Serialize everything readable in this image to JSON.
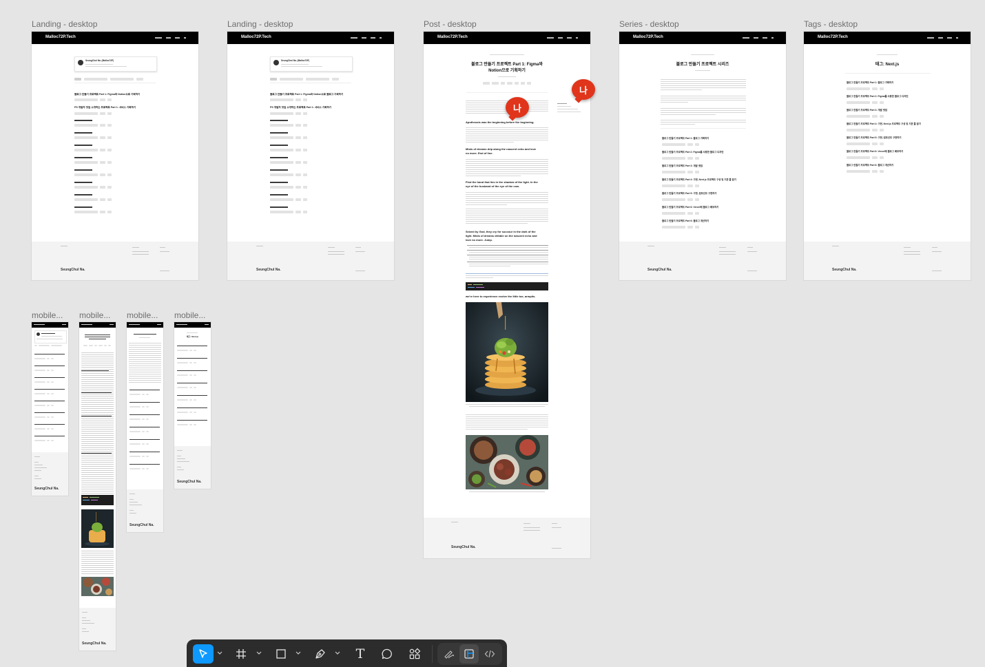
{
  "frames": {
    "landing_1": {
      "label": "Landing - desktop",
      "brand": "Malloc72P.Tech",
      "footer_name": "SeungChul Na.",
      "profile_name": "SeungChul Na. (Malloc72P)",
      "posts": [
        "블로그 만들기 프로젝트 Part 1: Figma와 Notion으로 기획하기",
        "PS 개발자 맛집 소개하는 프로젝트 Part 1: 서비스 기획하기"
      ]
    },
    "landing_2": {
      "label": "Landing - desktop",
      "brand": "Malloc72P.Tech",
      "footer_name": "SeungChul Na.",
      "profile_name": "SeungChul Na. (Malloc72P)",
      "posts": [
        "블로그 만들기 프로젝트 Part 1: Figma와 Notion으로 블로그 기획하기",
        "PS 개발자 맛집 소개하는 프로젝트 Part 1: 서비스 기획하기"
      ]
    },
    "post": {
      "label": "Post - desktop",
      "brand": "Malloc72P.Tech",
      "footer_name": "SeungChul Na.",
      "title_line1": "블로그 만들기 프로젝트 Part 1: Figma와",
      "title_line2": "Notion으로 기획하기",
      "h1": "Apotheosis was the beginning before the beginning.",
      "h2_line1": "Mists of dreams drip along the nascent echo and love",
      "h2_line2": "no more. End of line.",
      "h3_line1": "Find the hand that lies in the shadow of the light. In the",
      "h3_line2": "eye of the husband of the eye of the cow.",
      "h4_line1": "Seized by God, they cry for succour in the dark of the",
      "h4_line2": "light. Mists of dreams dribble on the nascent echo and",
      "h4_line3": "love no more. Jump.",
      "h5": "we're here to experience evolve the little toe, armpits."
    },
    "series": {
      "label": "Series - desktop",
      "brand": "Malloc72P.Tech",
      "footer_name": "SeungChul Na.",
      "title": "블로그 만들기 프로젝트 시리즈",
      "posts": [
        "블로그 만들기 프로젝트 Part 1: 블로그 기획하기",
        "블로그 만들기 프로젝트 Part 2: Figma를 사용한 블로그 디자인",
        "블로그 만들기 프로젝트 Part 3: 개발 셋업",
        "블로그 만들기 프로젝트 Part 4: 구현, Next.js 프로젝트 구성 및 기본 틀 잡기",
        "블로그 만들기 프로젝트 Part 5: 구현, 컴포넌트 구현하기",
        "블로그 만들기 프로젝트 Part 6: Vercel에 블로그 배포하기",
        "블로그 만들기 프로젝트 Part 6: 블로그 개선하기"
      ]
    },
    "tags": {
      "label": "Tags - desktop",
      "brand": "Malloc72P.Tech",
      "footer_name": "SeungChul Na.",
      "title": "태그: Next.js",
      "posts": [
        "블로그 만들기 프로젝트 Part 1: 블로그 기획하기",
        "블로그 만들기 프로젝트 Part 2: Figma를 사용한 블로그 디자인",
        "블로그 만들기 프로젝트 Part 3: 개발 셋업",
        "블로그 만들기 프로젝트 Part 4: 구현, Next.js 프로젝트 구성 및 기본 틀 잡기",
        "블로그 만들기 프로젝트 Part 5: 구현, 컴포넌트 구현하기",
        "블로그 만들기 프로젝트 Part 6: Vercel에 블로그 배포하기",
        "블로그 만들기 프로젝트 Part 6: 블로그 개선하기"
      ]
    },
    "mobile_1": {
      "label": "mobile...",
      "footer_name": "SeungChul Na."
    },
    "mobile_2": {
      "label": "mobile...",
      "footer_name": "SeungChul Na."
    },
    "mobile_3": {
      "label": "mobile...",
      "footer_name": "SeungChul Na."
    },
    "mobile_4": {
      "label": "mobile...",
      "footer_name": "SeungChul Na.",
      "title": "태그: Next.js"
    }
  },
  "cursors": [
    {
      "label": "나",
      "color": "#e0341b"
    },
    {
      "label": "나",
      "color": "#e0341b"
    }
  ],
  "toolbar": {
    "tools": [
      {
        "name": "move-tool",
        "icon": "pointer-arrow-icon",
        "active": true
      },
      {
        "name": "frame-tool",
        "icon": "hash-frame-icon"
      },
      {
        "name": "rectangle-tool",
        "icon": "square-icon"
      },
      {
        "name": "pen-tool",
        "icon": "pen-nib-icon"
      },
      {
        "name": "text-tool",
        "icon": "text-t-icon"
      },
      {
        "name": "comment-tool",
        "icon": "speech-bubble-icon"
      },
      {
        "name": "actions-tool",
        "icon": "components-grid-icon"
      },
      {
        "name": "draw-mode",
        "icon": "scribble-icon"
      },
      {
        "name": "design-mode",
        "icon": "layout-icon",
        "active": true
      },
      {
        "name": "dev-mode",
        "icon": "code-brackets-icon"
      }
    ],
    "text_tool_glyph": "T"
  }
}
